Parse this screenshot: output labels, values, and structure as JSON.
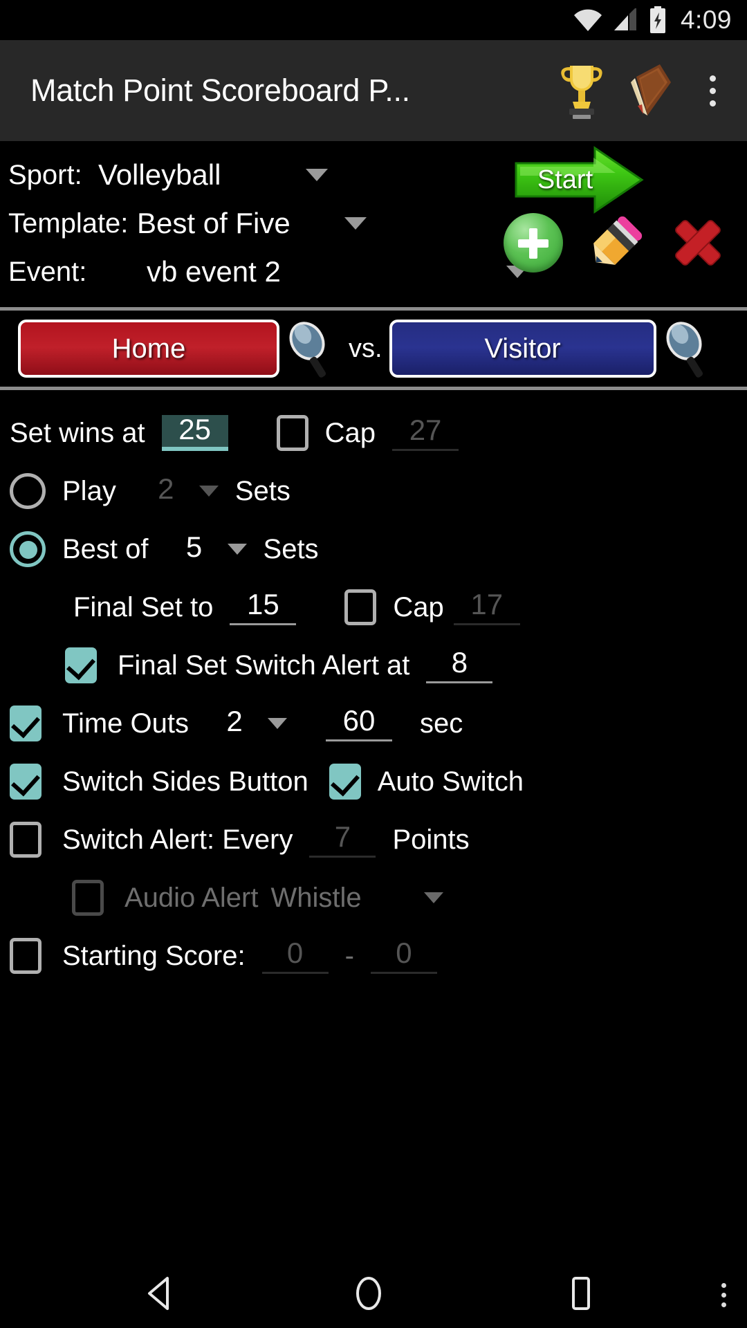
{
  "statusbar": {
    "time": "4:09",
    "icons": [
      "wifi-icon",
      "cell-signal-icon",
      "battery-charging-icon"
    ]
  },
  "appbar": {
    "title": "Match Point Scoreboard P...",
    "actions": [
      "trophy-icon",
      "book-icon",
      "overflow-menu-icon"
    ]
  },
  "selectors": {
    "sport": {
      "label": "Sport:",
      "value": "Volleyball"
    },
    "template": {
      "label": "Template:",
      "value": "Best of Five"
    },
    "event": {
      "label": "Event:",
      "value": "vb event 2"
    },
    "start_button": "Start",
    "action_icons": [
      "add-event-icon",
      "edit-event-icon",
      "delete-event-icon"
    ]
  },
  "teams": {
    "home": "Home",
    "vs": "vs.",
    "visitor": "Visitor",
    "search_icon": "magnifier-icon"
  },
  "settings": {
    "set_wins": {
      "label": "Set wins at",
      "value": "25",
      "selected": true
    },
    "set_cap": {
      "label": "Cap",
      "value": "27",
      "checked": false
    },
    "play": {
      "label": "Play",
      "value": "2",
      "suffix": "Sets",
      "selected": false
    },
    "best_of": {
      "label": "Best of",
      "value": "5",
      "suffix": "Sets",
      "selected": true
    },
    "final_set": {
      "label": "Final Set to",
      "value": "15"
    },
    "final_cap": {
      "label": "Cap",
      "value": "17",
      "checked": false
    },
    "final_switch_alert": {
      "label": "Final Set Switch Alert at",
      "value": "8",
      "checked": true
    },
    "time_outs": {
      "label": "Time Outs",
      "count": "2",
      "seconds": "60",
      "unit": "sec",
      "checked": true
    },
    "switch_sides_button": {
      "label": "Switch Sides Button",
      "checked": true
    },
    "auto_switch": {
      "label": "Auto Switch",
      "checked": true
    },
    "switch_alert": {
      "label": "Switch Alert: Every",
      "value": "7",
      "suffix": "Points",
      "checked": false
    },
    "audio_alert": {
      "label": "Audio Alert",
      "value": "Whistle",
      "checked": false,
      "enabled": false
    },
    "starting_score": {
      "label": "Starting Score:",
      "home": "0",
      "separator": "-",
      "visitor": "0",
      "checked": false
    }
  },
  "navbar": {
    "buttons": [
      "back-icon",
      "home-icon",
      "recents-icon",
      "overflow-icon"
    ]
  },
  "colors": {
    "accent_teal": "#80c6c2",
    "home_red": "#c0202a",
    "visitor_blue": "#2a3390",
    "start_green": "#3fc814",
    "appbar_bg": "#282828",
    "background": "#000000"
  }
}
